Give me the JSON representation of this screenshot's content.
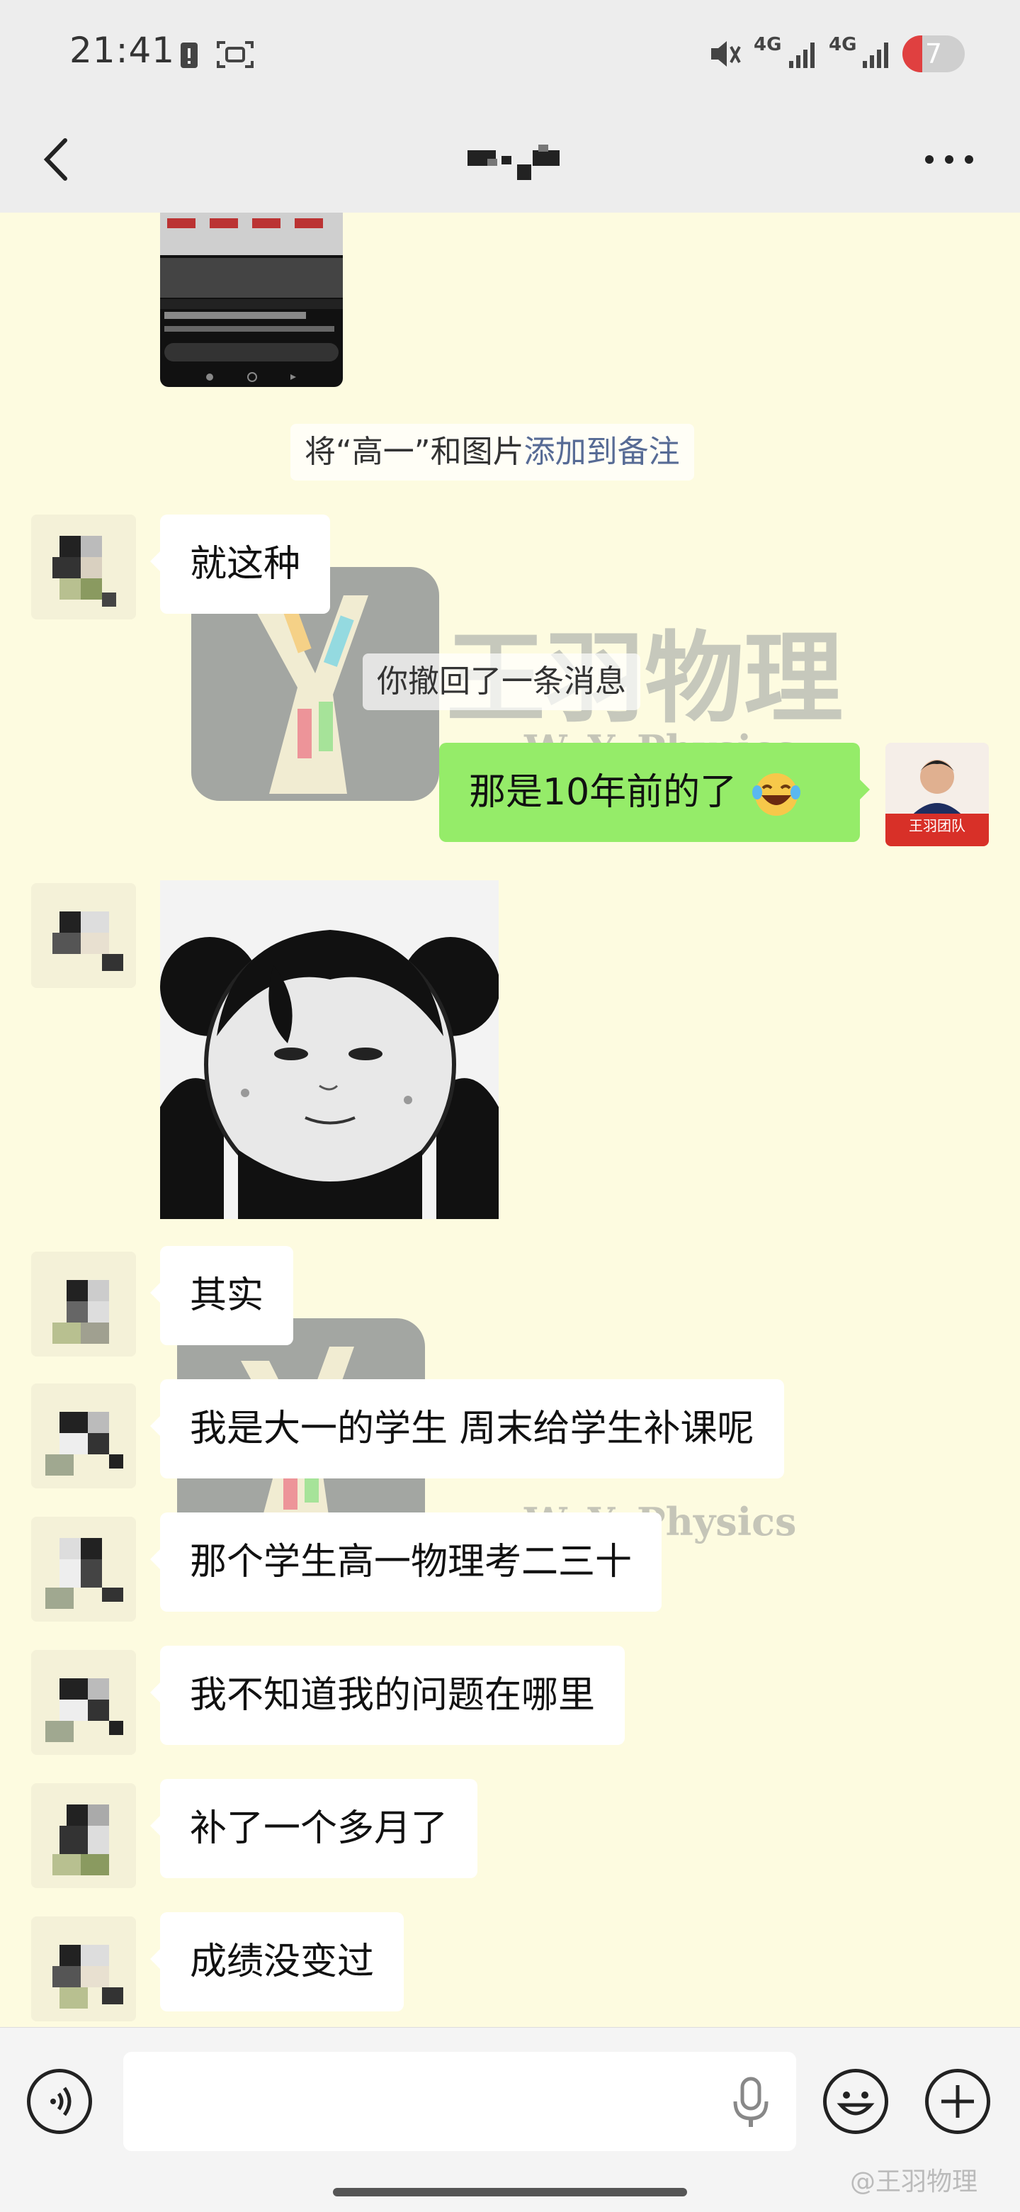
{
  "status_bar": {
    "time": "21:41",
    "network_1": "4G",
    "network_2": "4G",
    "battery": "7"
  },
  "header": {
    "back_icon": "chevron-left-icon",
    "more_icon": "more-dots-icon"
  },
  "system_notes": {
    "add_remark_prefix": "将“高一”和图片",
    "add_remark_link": "添加到备注",
    "recalled": "你撤回了一条消息"
  },
  "watermark": {
    "brand": "王羽物理",
    "tag": "W. Y. Physics"
  },
  "messages": [
    {
      "from": "other",
      "text": "就这种"
    },
    {
      "from": "me",
      "text": "那是10年前的了"
    },
    {
      "from": "other",
      "type": "sticker"
    },
    {
      "from": "other",
      "text": "其实"
    },
    {
      "from": "other",
      "text": "我是大一的学生 周末给学生补课呢"
    },
    {
      "from": "other",
      "text": "那个学生高一物理考二三十"
    },
    {
      "from": "other",
      "text": "我不知道我的问题在哪里"
    },
    {
      "from": "other",
      "text": "补了一个多月了"
    },
    {
      "from": "other",
      "text": "成绩没变过"
    }
  ],
  "my_avatar_label": "王羽团队",
  "input": {
    "voice_icon": "voice-icon",
    "mic_icon": "mic-icon",
    "emoji_icon": "emoji-icon",
    "add_icon": "add-icon"
  },
  "credit": "@王羽物理",
  "colors": {
    "my_bubble": "#95ec69",
    "other_bubble": "#ffffff",
    "chat_bg": "#fdfbe0",
    "link": "#576b95"
  }
}
